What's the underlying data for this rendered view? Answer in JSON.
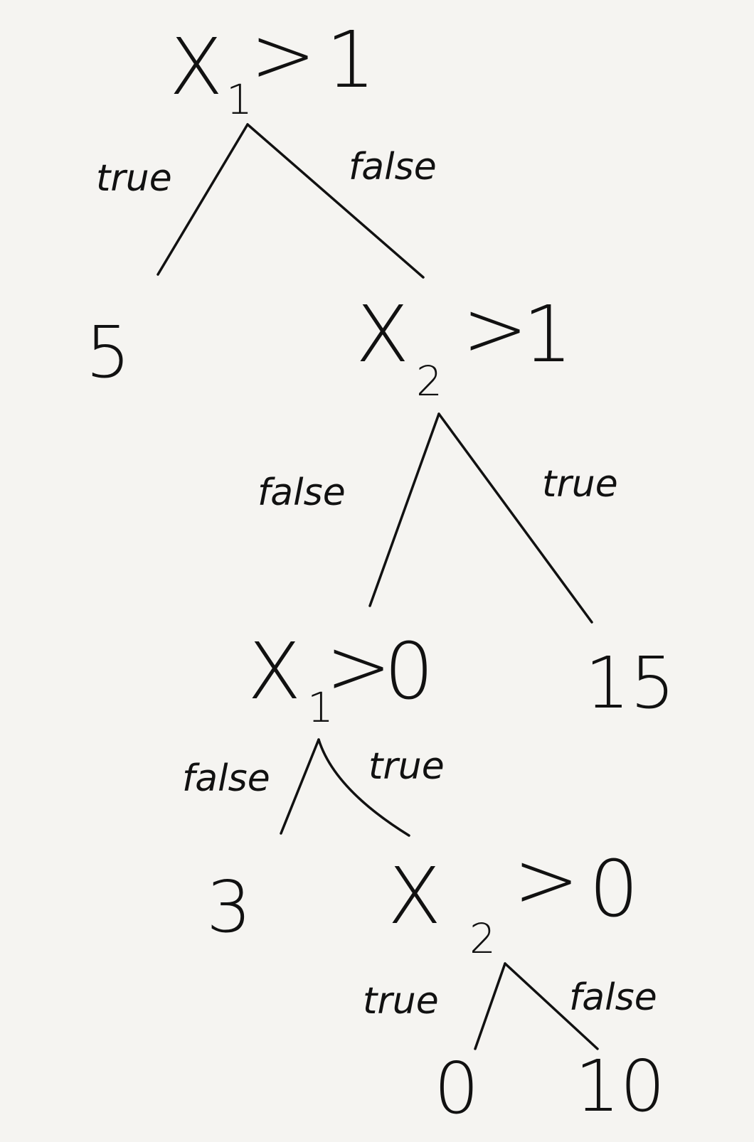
{
  "tree": {
    "root": {
      "var": "X",
      "sub": "1",
      "op": ">",
      "thr": "1"
    },
    "root_true_label": "true",
    "root_false_label": "false",
    "leaf_a": "5",
    "node2": {
      "var": "X",
      "sub": "2",
      "op": ">",
      "thr": "1"
    },
    "node2_false_label": "false",
    "node2_true_label": "true",
    "leaf_b": "15",
    "node3": {
      "var": "X",
      "sub": "1",
      "op": ">",
      "thr": "0"
    },
    "node3_false_label": "false",
    "node3_true_label": "true",
    "leaf_c": "3",
    "node4": {
      "var": "X",
      "sub": "2",
      "op": ">",
      "thr": "0"
    },
    "node4_true_label": "true",
    "node4_false_label": "false",
    "leaf_d": "0",
    "leaf_e": "10"
  }
}
